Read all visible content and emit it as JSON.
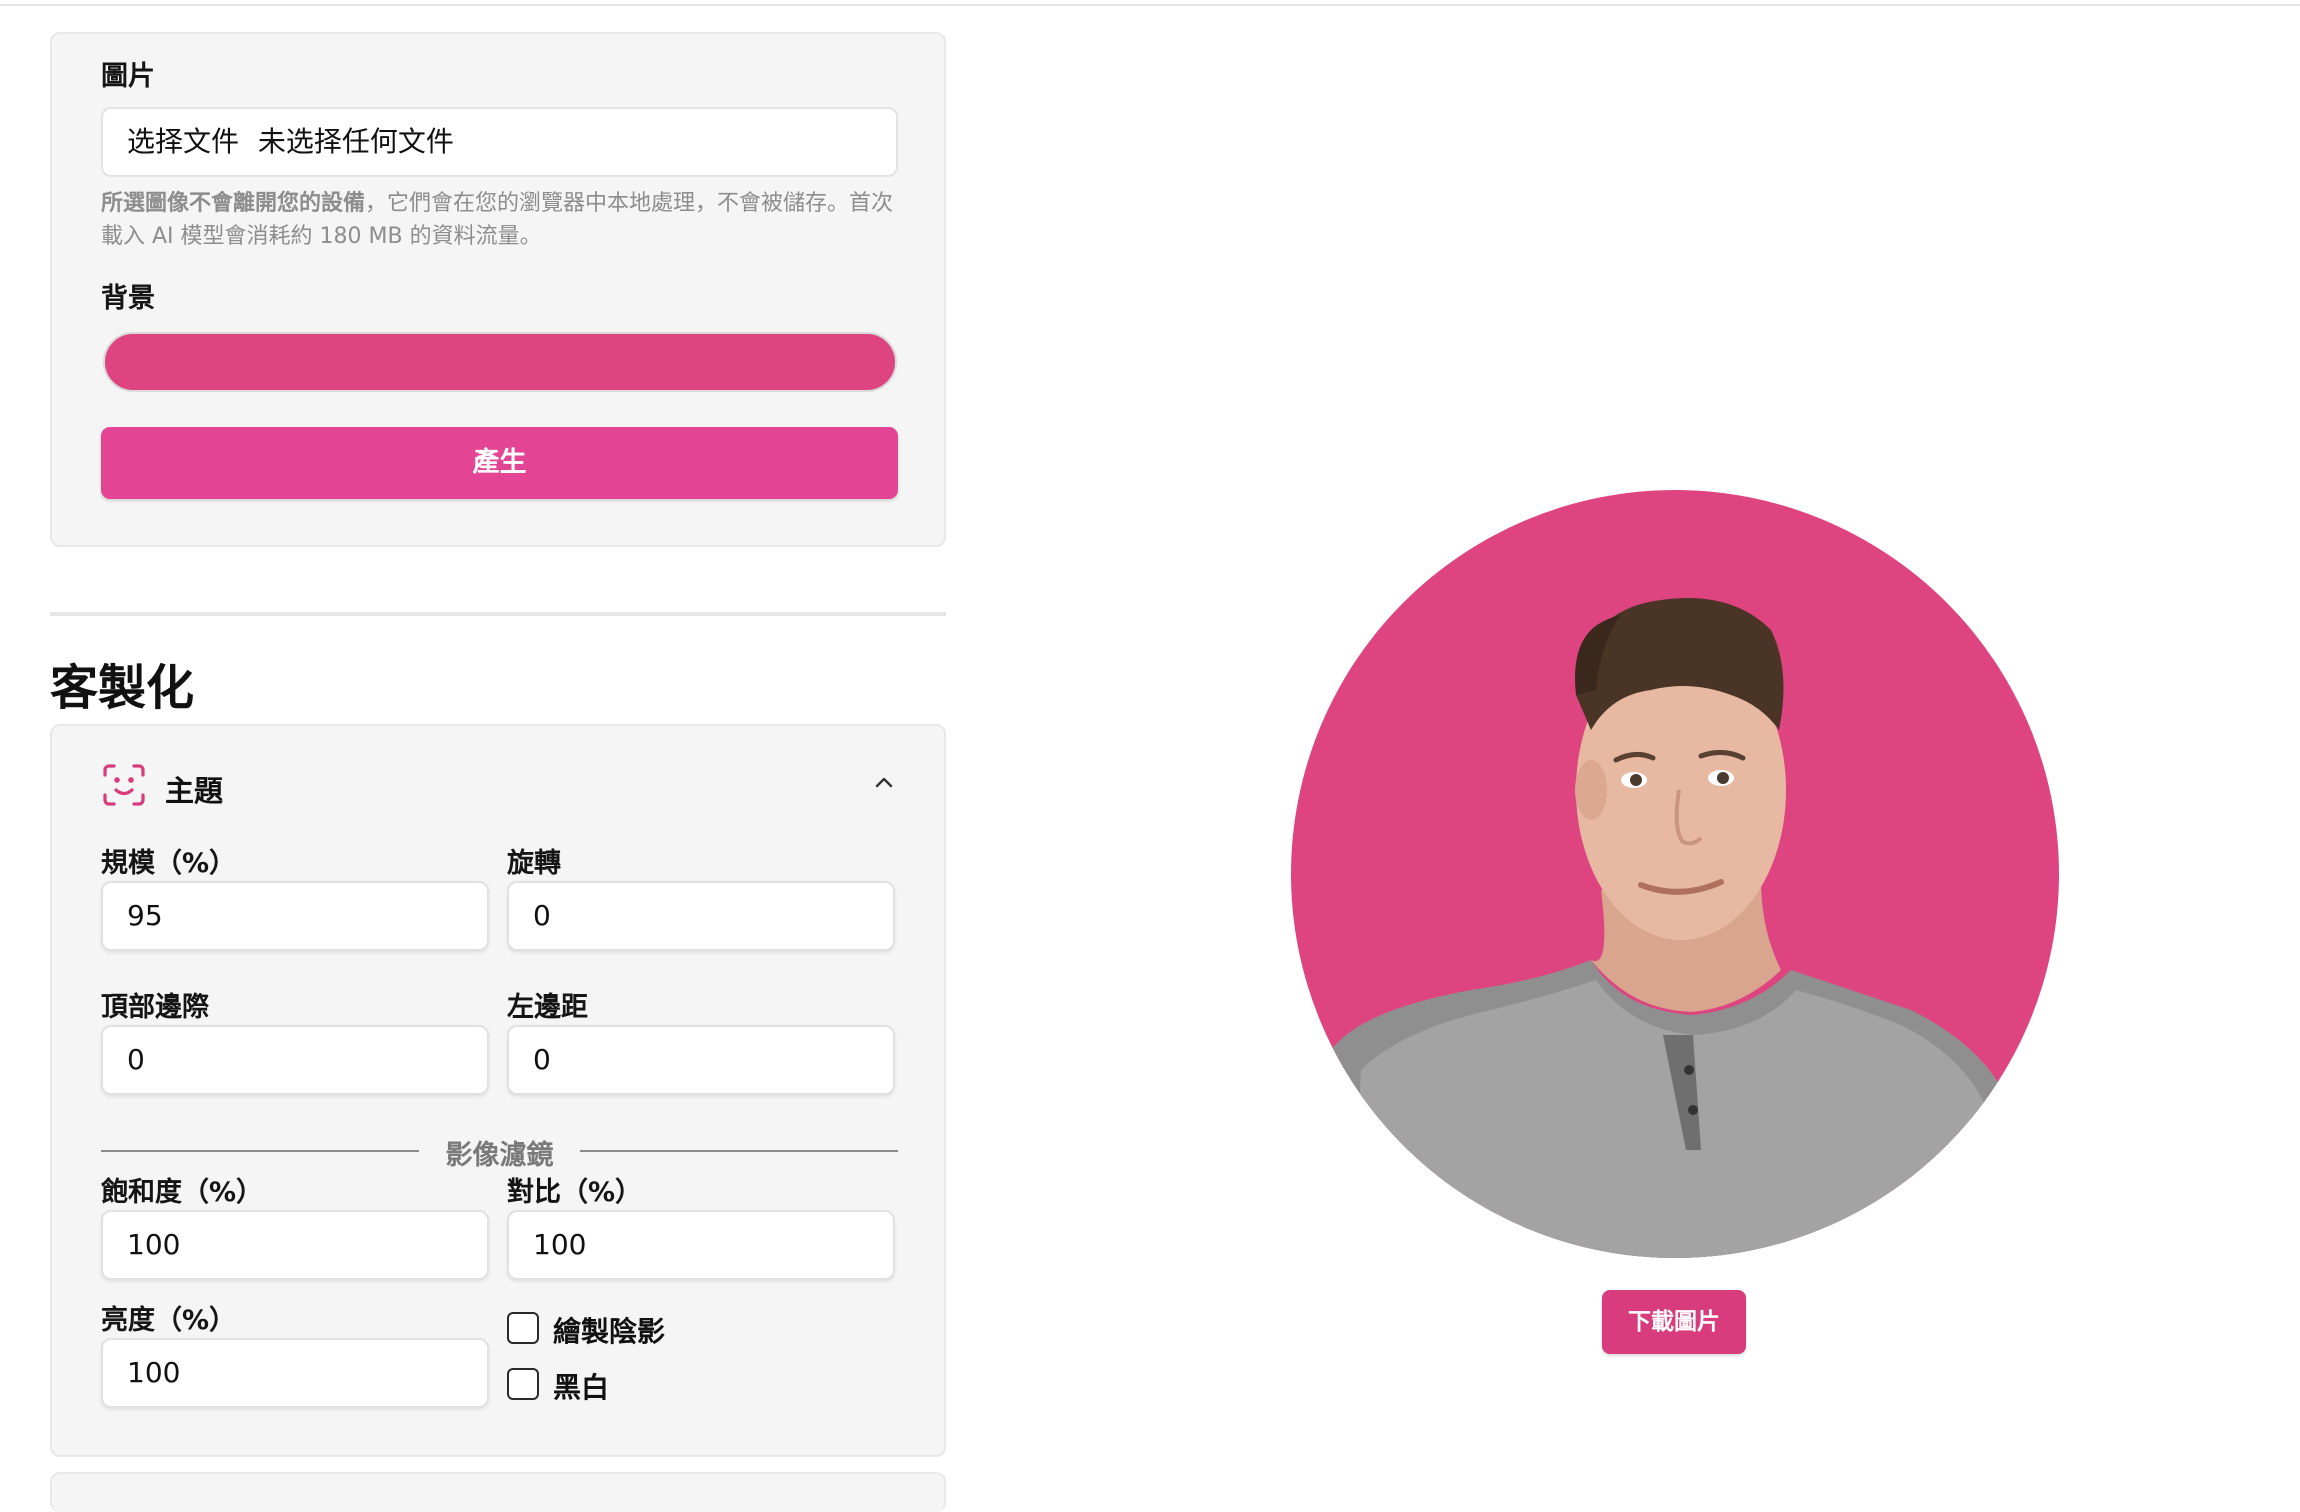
{
  "upload": {
    "image_label": "圖片",
    "file_button": "选择文件",
    "file_status": "未选择任何文件",
    "note_bold": "所選圖像不會離開您的設備",
    "note_rest": "，它們會在您的瀏覽器中本地處理，不會被儲存。首次載入 AI 模型會消耗約 180 MB 的資料流量。",
    "background_label": "背景",
    "background_color": "#de4580",
    "generate_label": "產生"
  },
  "customize": {
    "title": "客製化",
    "subject": {
      "title": "主題",
      "icon": "face-scan-icon",
      "scale_label": "規模（%）",
      "scale_value": "95",
      "rotate_label": "旋轉",
      "rotate_value": "0",
      "top_margin_label": "頂部邊際",
      "top_margin_value": "0",
      "left_margin_label": "左邊距",
      "left_margin_value": "0",
      "filters_label": "影像濾鏡",
      "saturation_label": "飽和度（%）",
      "saturation_value": "100",
      "contrast_label": "對比（%）",
      "contrast_value": "100",
      "brightness_label": "亮度（%）",
      "brightness_value": "100",
      "shadow_label": "繪製陰影",
      "shadow_checked": false,
      "bw_label": "黑白",
      "bw_checked": false
    }
  },
  "preview": {
    "download_label": "下載圖片",
    "accent_color": "#e34594"
  }
}
